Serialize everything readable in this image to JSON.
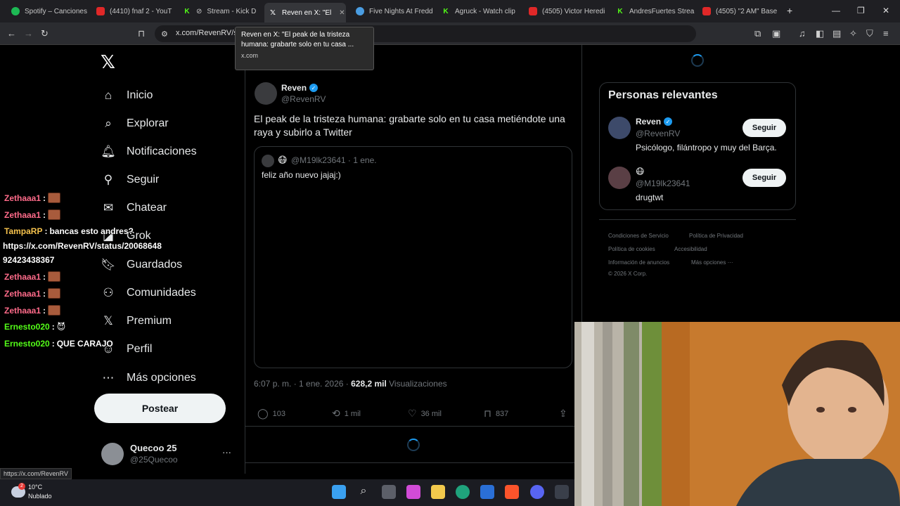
{
  "browser": {
    "tabs": [
      {
        "label": "Spotify – Canciones",
        "icon": "spotify-icon"
      },
      {
        "label": "(4410) fnaf 2 - YouT",
        "icon": "youtube-icon"
      },
      {
        "label": "Stream - Kick D",
        "icon": "kick-icon"
      },
      {
        "label": "Reven en X: \"El",
        "icon": "x-icon",
        "active": true
      },
      {
        "label": "Five Nights At Fredd",
        "icon": "fnaf-icon"
      },
      {
        "label": "Agruck - Watch clip",
        "icon": "kick-icon"
      },
      {
        "label": "(4505) Victor Heredi",
        "icon": "youtube-icon"
      },
      {
        "label": "AndresFuertes Strea",
        "icon": "kick-icon"
      },
      {
        "label": "(4505) \"2 AM\" Base",
        "icon": "youtube-icon"
      }
    ],
    "new_tab": "+",
    "url": "x.com/RevenRV/s",
    "tooltip": {
      "title": "Reven en X: \"El peak de la tristeza humana: grabarte solo en tu casa ...",
      "host": "x.com"
    },
    "status_url": "https://x.com/RevenRV"
  },
  "nav": {
    "items": [
      {
        "label": "Inicio",
        "icon": "home-icon",
        "glyph": "⌂"
      },
      {
        "label": "Explorar",
        "icon": "search-icon",
        "glyph": "⌕"
      },
      {
        "label": "Notificaciones",
        "icon": "bell-icon",
        "glyph": "🔔︎"
      },
      {
        "label": "Seguir",
        "icon": "follow-icon",
        "glyph": "⚲"
      },
      {
        "label": "Chatear",
        "icon": "mail-icon",
        "glyph": "✉"
      },
      {
        "label": "Grok",
        "icon": "grok-icon",
        "glyph": "◪"
      },
      {
        "label": "Guardados",
        "icon": "bookmark-icon",
        "glyph": "🔖︎"
      },
      {
        "label": "Comunidades",
        "icon": "communities-icon",
        "glyph": "⚇"
      },
      {
        "label": "Premium",
        "icon": "x-premium-icon",
        "glyph": "𝕏"
      },
      {
        "label": "Perfil",
        "icon": "profile-icon",
        "glyph": "☺"
      },
      {
        "label": "Más opciones",
        "icon": "more-circle-icon",
        "glyph": "⋯"
      }
    ],
    "post_button": "Postear",
    "account": {
      "name": "Quecoo 25",
      "handle": "@25Quecoo",
      "more": "···"
    }
  },
  "post": {
    "author": "Reven",
    "handle": "@RevenRV",
    "text": "El peak de la tristeza humana: grabarte solo en tu casa metiéndote una raya y subirlo a Twitter",
    "quote": {
      "handle": "@M19lk23641 · 1 ene.",
      "emoji": "😷",
      "text": "feliz año nuevo jajaj:)"
    },
    "time": "6:07 p. m. · 1 ene. 2026 · ",
    "views_count": "628,2 mil",
    "views_label": " Visualizaciones",
    "stats": {
      "replies": "103",
      "reposts": "1 mil",
      "likes": "36 mil",
      "bookmarks": "837"
    }
  },
  "sidebar": {
    "title": "Personas relevantes",
    "people": [
      {
        "name": "Reven",
        "handle": "@RevenRV",
        "bio": "Psicólogo, filántropo y muy del Barça.",
        "button": "Seguir"
      },
      {
        "name": "😷",
        "handle": "@M19lk23641",
        "bio": "drugtwt",
        "button": "Seguir"
      }
    ],
    "footer": [
      "Condiciones de Servicio",
      "Política de Privacidad",
      "Política de cookies",
      "Accesibilidad",
      "Información de anuncios",
      "Más opciones ···",
      "© 2026 X Corp."
    ]
  },
  "chat": [
    {
      "user": "Zethaaa1",
      "text": "",
      "emote": true
    },
    {
      "user": "Zethaaa1",
      "text": "",
      "emote": true
    },
    {
      "user": "TampaRP",
      "text": "bancas esto andres?",
      "emote": false
    },
    {
      "user": "",
      "text": "https://x.com/RevenRV/status/20068648",
      "emote": false
    },
    {
      "user": "",
      "text": "92423438367",
      "emote": false
    },
    {
      "user": "Zethaaa1",
      "text": "",
      "emote": true
    },
    {
      "user": "Zethaaa1",
      "text": "",
      "emote": true
    },
    {
      "user": "Zethaaa1",
      "text": "",
      "emote": true
    },
    {
      "user": "Ernesto020",
      "text": "😈",
      "emote": false
    },
    {
      "user": "Ernesto020",
      "text": "QUE CARAJO",
      "emote": false
    }
  ],
  "taskbar": {
    "temp": "10°C",
    "weather": "Nublado",
    "badge": "2"
  }
}
